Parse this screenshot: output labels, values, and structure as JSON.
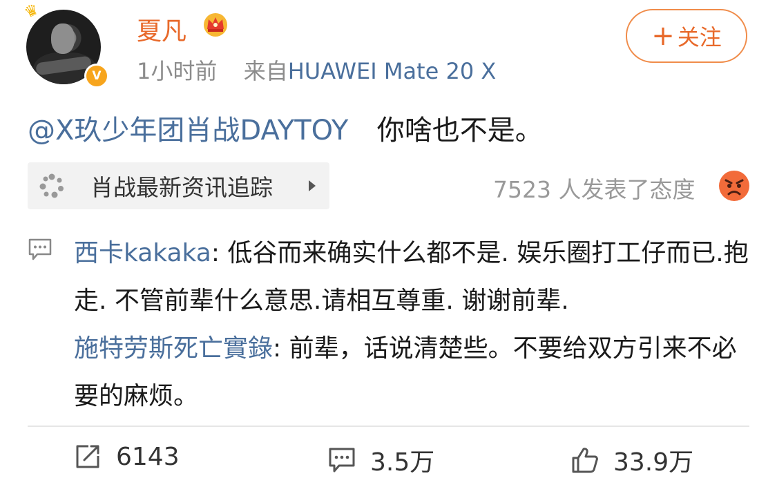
{
  "post": {
    "author": {
      "name": "夏凡",
      "verified_badge": "V"
    },
    "time": "1小时前",
    "source_prefix": "来自",
    "source": "HUAWEI Mate 20 X",
    "follow_label": "关注",
    "follow_plus": "+",
    "mention": "@X玖少年团肖战DAYTOY",
    "text": "你啥也不是。",
    "topic": {
      "label": "肖战最新资讯追踪",
      "icon": "topic-icon"
    },
    "reactions": {
      "count_text": "7523 人发表了态度",
      "icon": "angry-emoji-icon"
    }
  },
  "comments": [
    {
      "name": "西卡kakaka",
      "text": ": 低谷而来确实什么都不是. 娱乐圈打工仔而已.抱走. 不管前辈什么意思.请相互尊重. 谢谢前辈."
    },
    {
      "name": "施特劳斯死亡實錄",
      "text": ": 前辈，话说清楚些。不要给双方引来不必要的麻烦。"
    }
  ],
  "actions": {
    "repost": {
      "count": "6143",
      "icon": "share-icon"
    },
    "comment": {
      "count": "3.5万",
      "icon": "comment-icon"
    },
    "like": {
      "count": "33.9万",
      "icon": "thumbs-up-icon"
    }
  },
  "colors": {
    "username": "#e8692a",
    "link": "#4a6f9c",
    "meta": "#8c8c8c",
    "follow_border": "#f08c4a",
    "verified": "#f7a51d"
  }
}
